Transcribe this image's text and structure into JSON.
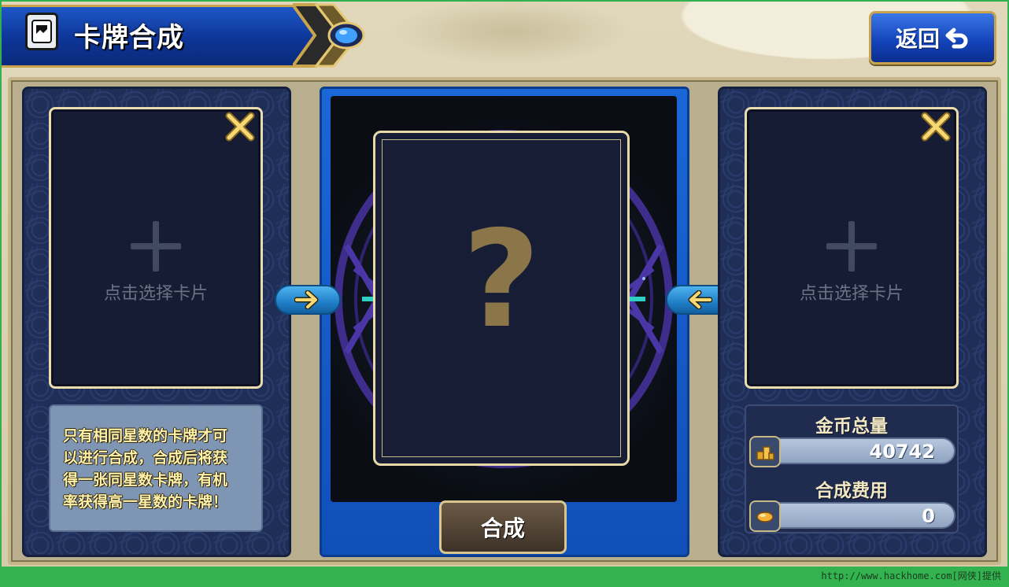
{
  "header": {
    "title": "卡牌合成",
    "back_label": "返回",
    "title_icon": "card-icon",
    "back_icon": "return-arrow-icon"
  },
  "left_slot": {
    "label": "点击选择卡片",
    "close_icon": "close-x-icon"
  },
  "right_slot": {
    "label": "点击选择卡片",
    "close_icon": "close-x-icon"
  },
  "info": {
    "lines": [
      "只有相同星数的卡牌才可",
      "以进行合成，合成后将获",
      "得一张同星数卡牌，有机",
      "率获得高一星数的卡牌！"
    ]
  },
  "result": {
    "placeholder": "?"
  },
  "compose_button": "合成",
  "stats": {
    "gold_label": "金币总量",
    "gold_value": "40742",
    "cost_label": "合成费用",
    "cost_value": "0"
  },
  "watermark": "http://www.hackhome.com[网侠]提供",
  "colors": {
    "accent_blue": "#1241b8",
    "gold_border": "#c9a44c",
    "info_text": "#fff1a8",
    "green_bar": "#33b34f"
  }
}
